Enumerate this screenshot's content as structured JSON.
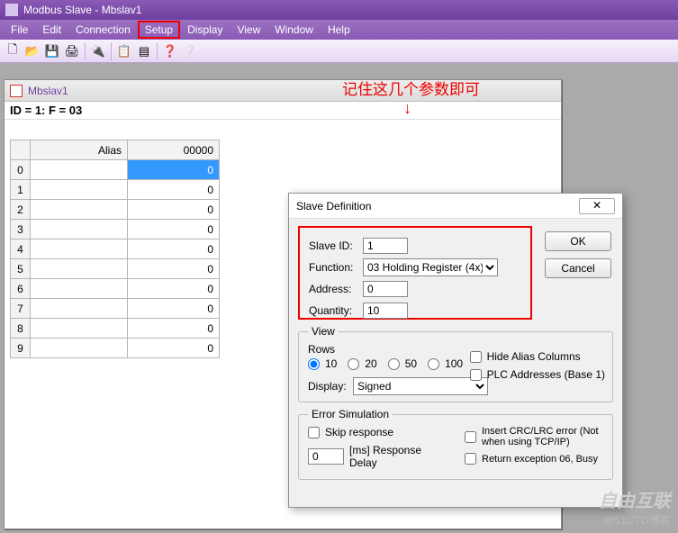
{
  "title": "Modbus Slave - Mbslav1",
  "menus": [
    "File",
    "Edit",
    "Connection",
    "Setup",
    "Display",
    "View",
    "Window",
    "Help"
  ],
  "menu_highlight_index": 3,
  "toolbar_icons": [
    "new-icon",
    "open-icon",
    "save-icon",
    "print-icon",
    "|",
    "connect-icon",
    "|",
    "props-icon",
    "exec-icon",
    "|",
    "help-icon",
    "context-help-icon"
  ],
  "doc": {
    "title": "Mbslav1",
    "info": "ID = 1: F = 03",
    "columns": [
      "",
      "Alias",
      "00000"
    ],
    "rows": [
      {
        "n": "0",
        "alias": "",
        "val": "0",
        "sel": true
      },
      {
        "n": "1",
        "alias": "",
        "val": "0"
      },
      {
        "n": "2",
        "alias": "",
        "val": "0"
      },
      {
        "n": "3",
        "alias": "",
        "val": "0"
      },
      {
        "n": "4",
        "alias": "",
        "val": "0"
      },
      {
        "n": "5",
        "alias": "",
        "val": "0"
      },
      {
        "n": "6",
        "alias": "",
        "val": "0"
      },
      {
        "n": "7",
        "alias": "",
        "val": "0"
      },
      {
        "n": "8",
        "alias": "",
        "val": "0"
      },
      {
        "n": "9",
        "alias": "",
        "val": "0"
      }
    ]
  },
  "annotation": "记住这几个参数即可",
  "dialog": {
    "title": "Slave Definition",
    "slave_id_label": "Slave ID:",
    "slave_id": "1",
    "function_label": "Function:",
    "function": "03 Holding Register (4x)",
    "address_label": "Address:",
    "address": "0",
    "quantity_label": "Quantity:",
    "quantity": "10",
    "ok": "OK",
    "cancel": "Cancel",
    "view_legend": "View",
    "rows_label": "Rows",
    "row_options": [
      "10",
      "20",
      "50",
      "100"
    ],
    "row_selected": "10",
    "hide_alias": "Hide Alias Columns",
    "plc_addr": "PLC Addresses (Base 1)",
    "display_label": "Display:",
    "display_value": "Signed",
    "err_legend": "Error Simulation",
    "skip_response": "Skip response",
    "delay_value": "0",
    "delay_suffix": "[ms] Response Delay",
    "insert_crc": "Insert CRC/LRC error (Not when using TCP/IP)",
    "return_exc": "Return exception 06, Busy"
  },
  "watermark": {
    "big": "自由互联",
    "small": "@51CTO博客"
  }
}
